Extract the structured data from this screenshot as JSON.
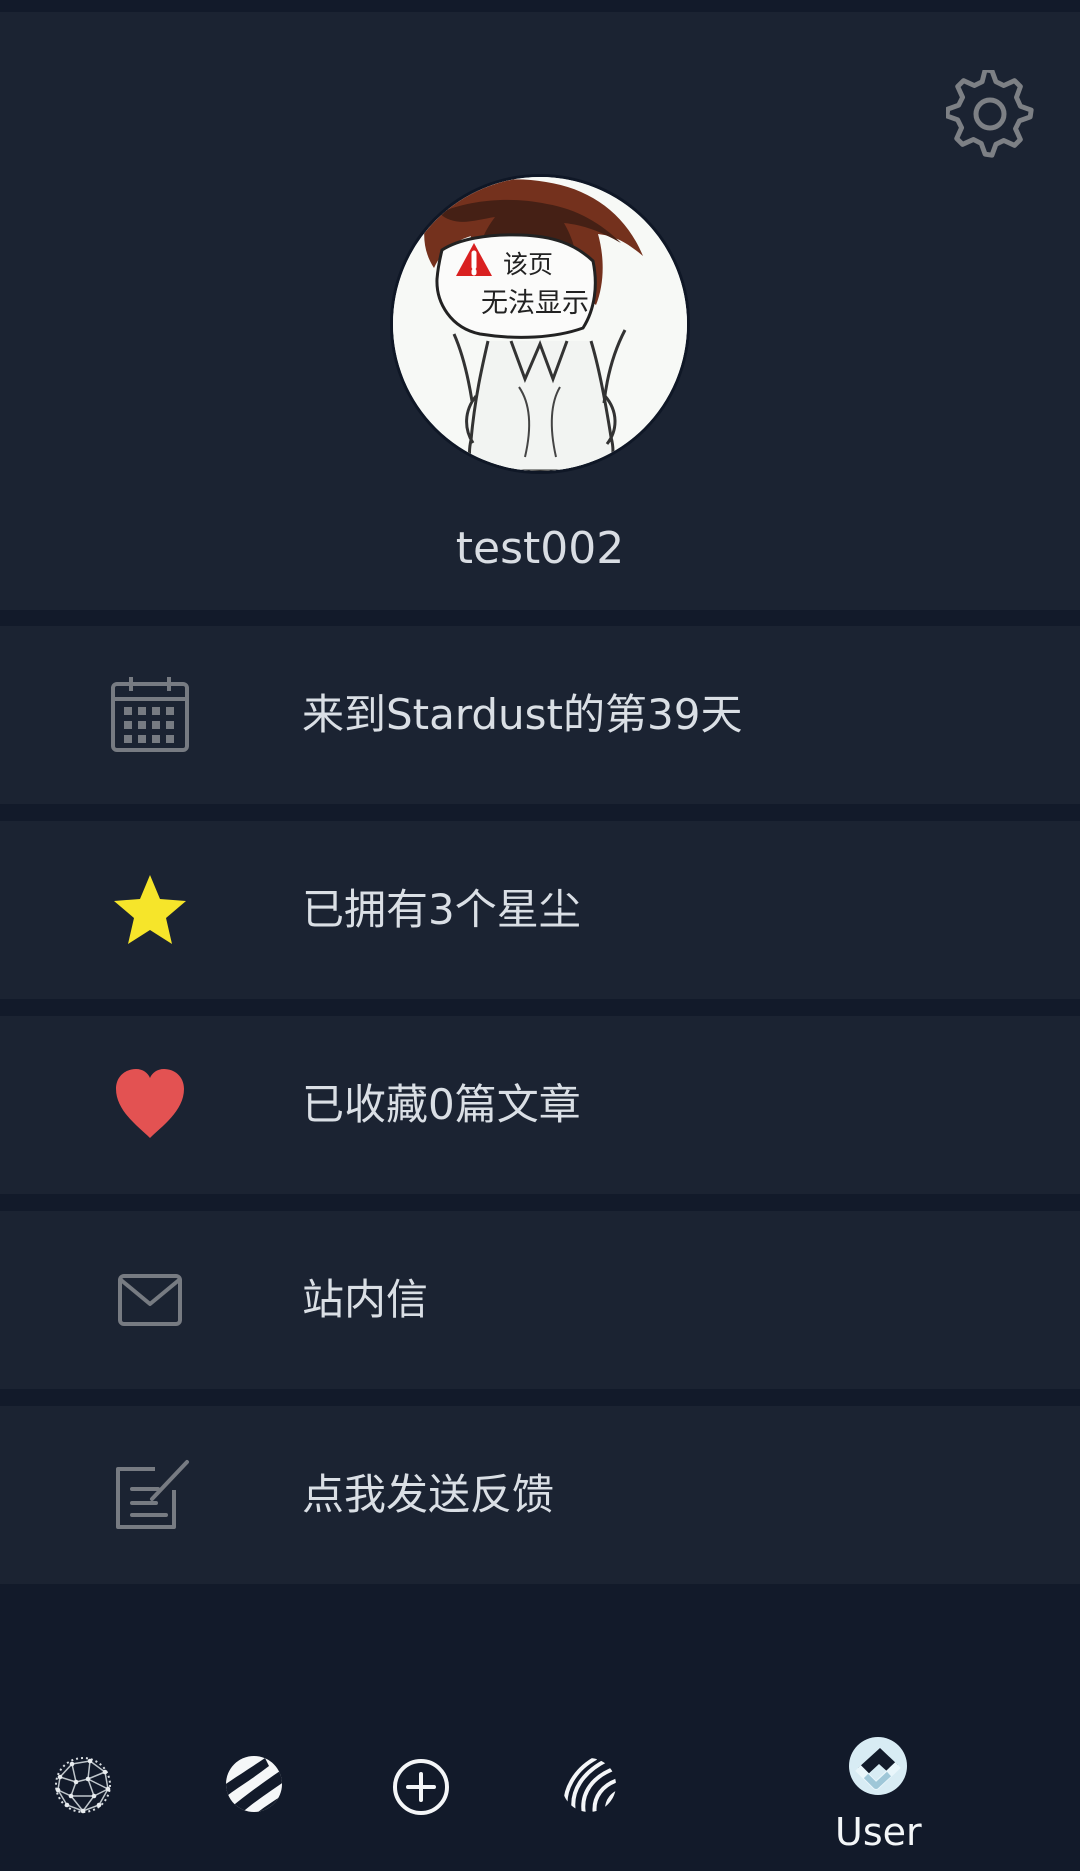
{
  "profile": {
    "username": "test002",
    "settings_icon": "gear-icon",
    "avatar_icon": "avatar-image"
  },
  "menu": {
    "items": [
      {
        "label": "来到Stardust的第39天",
        "icon": "calendar-icon"
      },
      {
        "label": "已拥有3个星尘",
        "icon": "star-icon",
        "color": "#f6e52a"
      },
      {
        "label": "已收藏0篇文章",
        "icon": "heart-icon",
        "color": "#e35252"
      },
      {
        "label": "站内信",
        "icon": "mail-icon"
      },
      {
        "label": "点我发送反馈",
        "icon": "feedback-edit-icon"
      }
    ]
  },
  "bottom_nav": {
    "items": [
      {
        "icon": "network-globe-icon"
      },
      {
        "icon": "striped-sphere-icon"
      },
      {
        "icon": "plus-circle-icon"
      },
      {
        "icon": "wave-sphere-icon"
      },
      {
        "icon": "user-icon",
        "label": "User",
        "active": true
      }
    ]
  },
  "colors": {
    "background": "#121a2a",
    "panel": "#1b2332",
    "text": "#dadfe5"
  }
}
